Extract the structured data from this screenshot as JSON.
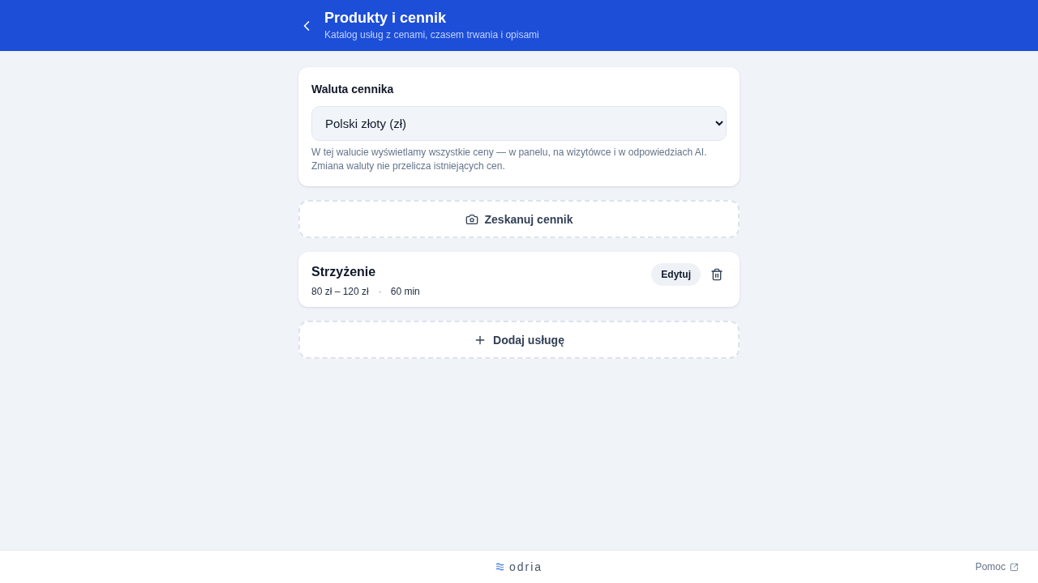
{
  "header": {
    "title": "Produkty i cennik",
    "subtitle": "Katalog usług z cenami, czasem trwania i opisami"
  },
  "currency": {
    "label": "Waluta cennika",
    "value": "Polski złoty (zł)",
    "help": "W tej walucie wyświetlamy wszystkie ceny — w panelu, na wizytówce i w odpowiedziach AI. Zmiana waluty nie przelicza istniejących cen."
  },
  "scan_button": {
    "label": "Zeskanuj cennik"
  },
  "services": [
    {
      "name": "Strzyżenie",
      "price": "80 zł – 120 zł",
      "duration": "60 min",
      "edit_label": "Edytuj"
    }
  ],
  "add_button": {
    "label": "Dodaj usługę"
  },
  "footer": {
    "logo": "odria",
    "help_link": "Pomoc"
  }
}
